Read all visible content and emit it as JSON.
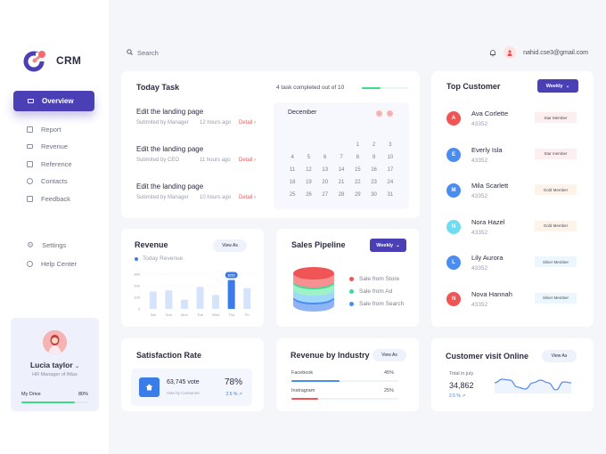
{
  "app": {
    "logo_text": "CRM"
  },
  "sidebar": {
    "active": {
      "label": "Overview",
      "icon": "overview-icon"
    },
    "items": [
      {
        "label": "Report",
        "icon": "report-icon"
      },
      {
        "label": "Revenue",
        "icon": "revenue-icon"
      },
      {
        "label": "Reference",
        "icon": "reference-icon"
      },
      {
        "label": "Contacts",
        "icon": "contacts-icon"
      },
      {
        "label": "Feedback",
        "icon": "feedback-icon"
      }
    ],
    "bottom_items": [
      {
        "label": "Settings",
        "icon": "gear-icon"
      },
      {
        "label": "Help Center",
        "icon": "info-icon"
      }
    ],
    "profile": {
      "name": "Lucia taylor",
      "role": "HR Manager of Atlas",
      "drive_label": "My Drive",
      "drive_percent_label": "80%",
      "drive_fraction": 0.8,
      "drive_color": "#3ddc84"
    }
  },
  "topbar": {
    "search_placeholder": "Search",
    "user_email": "nahid.cse3@gmail.com"
  },
  "today_task": {
    "title": "Today Task",
    "progress_text": "4 task completed out of 10",
    "progress_fraction": 0.4,
    "tasks": [
      {
        "title": "Edit the landing page",
        "submitted_by": "Submited by Manager",
        "time": "12 hours ago",
        "action": "Detail ›"
      },
      {
        "title": "Edit the landing page",
        "submitted_by": "Submited by CEO",
        "time": "11 hours ago",
        "action": "Detail ›"
      },
      {
        "title": "Edit the landing page",
        "submitted_by": "Submited by Manager",
        "time": "10 hours ago",
        "action": "Detail ›"
      }
    ],
    "calendar": {
      "month": "December",
      "prev": "‹",
      "next": "›",
      "leading_blanks": 4,
      "days": 31
    }
  },
  "top_customer": {
    "title": "Top Customer",
    "filter": "Weekly",
    "customers": [
      {
        "initial": "A",
        "name": "Ava Corlette",
        "id": "43352",
        "badge": "Star Member",
        "color": "#f05454",
        "badge_bg": "#fdeef0"
      },
      {
        "initial": "E",
        "name": "Everly Isla",
        "id": "43352",
        "badge": "Star member",
        "color": "#4b8cf0",
        "badge_bg": "#fdeef0"
      },
      {
        "initial": "M",
        "name": "Mila Scarlett",
        "id": "43352",
        "badge": "Gold Member",
        "color": "#4b8cf0",
        "badge_bg": "#fdf3e8"
      },
      {
        "initial": "N",
        "name": "Nora Hazel",
        "id": "43352",
        "badge": "Gold Member",
        "color": "#6fdcef",
        "badge_bg": "#fdf3e8"
      },
      {
        "initial": "L",
        "name": "Lily Aurora",
        "id": "43352",
        "badge": "Silver Member",
        "color": "#4b8cf0",
        "badge_bg": "#ecf6fd"
      },
      {
        "initial": "N",
        "name": "Nova Hannah",
        "id": "43352",
        "badge": "Silver Member",
        "color": "#f05454",
        "badge_bg": "#ecf6fd"
      }
    ]
  },
  "revenue": {
    "title": "Revenue",
    "view_label": "View As",
    "legend": "Today Revenue",
    "highlight_label": "$250"
  },
  "sales_pipeline": {
    "title": "Sales Pipeline",
    "filter": "Weekly",
    "legend": [
      {
        "label": "Sale from Store",
        "color": "#f05454"
      },
      {
        "label": "Sale from Ad",
        "color": "#3ddc97"
      },
      {
        "label": "Sale from Search",
        "color": "#4b8cf0"
      }
    ]
  },
  "satisfaction": {
    "title": "Satisfaction Rate",
    "votes": "63,745 vote",
    "votes_sub": "Vote by Consumer",
    "rate": "78%",
    "change": "2.5 % ↗"
  },
  "revenue_by_industry": {
    "title": "Revenue by Industry",
    "view_label": "View As",
    "rows": [
      {
        "label": "Facebook",
        "value_label": "45%",
        "fraction": 0.45,
        "color": "#4b8cf0"
      },
      {
        "label": "Instragram",
        "value_label": "25%",
        "fraction": 0.25,
        "color": "#f05454"
      }
    ]
  },
  "customer_visit": {
    "title": "Customer visit Online",
    "view_label": "View As",
    "total_label": "Total in july",
    "total": "34,862",
    "change": "2.5 % ↗",
    "sparkline": [
      0.55,
      0.75,
      0.7,
      0.3,
      0.2,
      0.55,
      0.7,
      0.55,
      0.15,
      0.6,
      0.55
    ]
  },
  "chart_data": {
    "type": "bar",
    "title": "Revenue",
    "categories": [
      "Sat",
      "Sun",
      "Mon",
      "Tue",
      "Wed",
      "Thu",
      "Fri"
    ],
    "series": [
      {
        "name": "Today Revenue",
        "values": [
          150,
          160,
          80,
          190,
          120,
          250,
          180
        ]
      }
    ],
    "highlight_index": 5,
    "yticks": [
      0,
      100,
      200,
      300
    ],
    "ylim": [
      0,
      300
    ],
    "xlabel": "",
    "ylabel": "",
    "grid": true,
    "colors": {
      "bar": "#d6e4fb",
      "highlight": "#3a7ce8"
    }
  }
}
